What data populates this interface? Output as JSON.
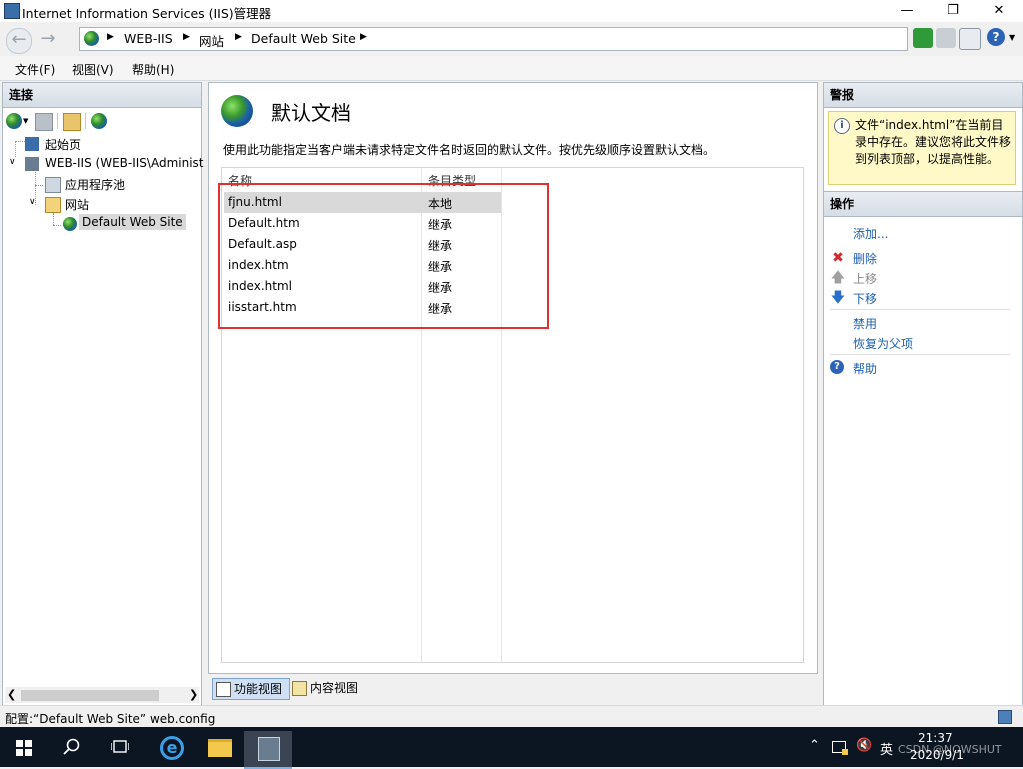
{
  "window": {
    "title": "Internet Information Services (IIS)管理器",
    "minimize_glyph": "—",
    "restore_glyph": "❐",
    "close_glyph": "✕"
  },
  "addressbar": {
    "crumbs": [
      "WEB-IIS",
      "网站",
      "Default Web Site"
    ]
  },
  "menu": {
    "file": "文件(F)",
    "view": "视图(V)",
    "help": "帮助(H)"
  },
  "left": {
    "header": "连接",
    "tree": {
      "start_page": "起始页",
      "server": "WEB-IIS (WEB-IIS\\Administ",
      "app_pools": "应用程序池",
      "sites": "网站",
      "default_site": "Default Web Site"
    }
  },
  "center": {
    "title": "默认文档",
    "description": "使用此功能指定当客户端未请求特定文件名时返回的默认文件。按优先级顺序设置默认文档。",
    "columns": {
      "name": "名称",
      "type": "条目类型"
    },
    "rows": [
      {
        "name": "fjnu.html",
        "type": "本地"
      },
      {
        "name": "Default.htm",
        "type": "继承"
      },
      {
        "name": "Default.asp",
        "type": "继承"
      },
      {
        "name": "index.htm",
        "type": "继承"
      },
      {
        "name": "index.html",
        "type": "继承"
      },
      {
        "name": "iisstart.htm",
        "type": "继承"
      }
    ],
    "tabs": {
      "features": "功能视图",
      "content": "内容视图"
    }
  },
  "right": {
    "alerts_header": "警报",
    "alert_text": "文件“index.html”在当前目录中存在。建议您将此文件移到列表顶部，以提高性能。",
    "actions_header": "操作",
    "actions": {
      "add": "添加...",
      "delete": "删除",
      "move_up": "上移",
      "move_down": "下移",
      "disable": "禁用",
      "revert": "恢复为父项",
      "help": "帮助"
    }
  },
  "status": {
    "text": "配置:“Default Web Site” web.config"
  },
  "taskbar": {
    "ime": "英",
    "time": "21:37",
    "date": "2020/9/1",
    "watermark": "CSDN @NOWSHUT"
  },
  "colors": {
    "highlight_box": "#e03030",
    "link": "#1d5fb0",
    "taskbar": "#0c1622"
  }
}
